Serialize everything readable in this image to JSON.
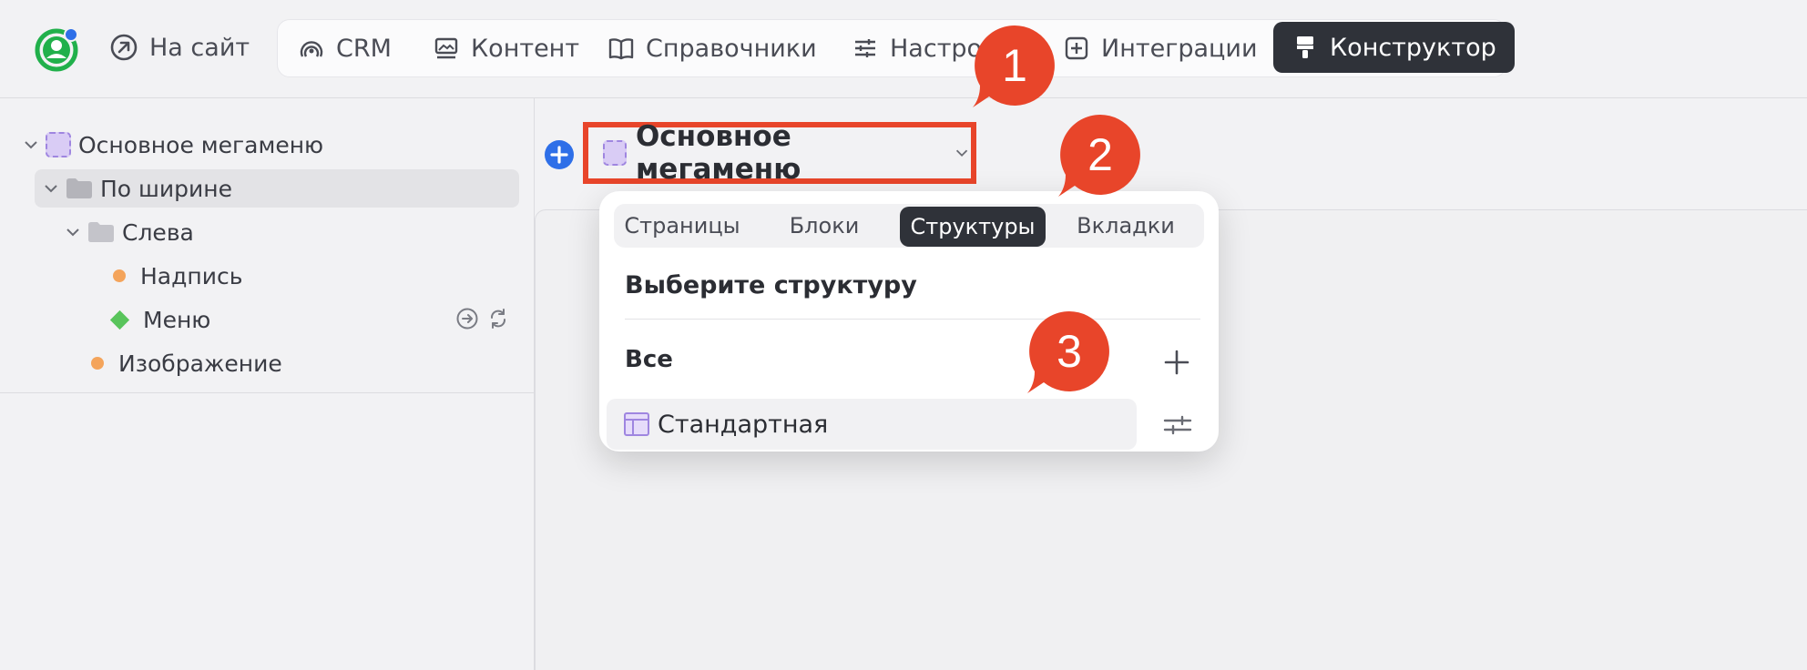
{
  "topbar": {
    "site_link": "На сайт",
    "nav": [
      {
        "label": "CRM",
        "icon": "crm-icon"
      },
      {
        "label": "Контент",
        "icon": "content-icon"
      },
      {
        "label": "Справочники",
        "icon": "book-icon"
      },
      {
        "label": "Настро",
        "icon": "sliders-icon"
      },
      {
        "label": "Интеграции",
        "icon": "plus-square-icon"
      },
      {
        "label": "Конструктор",
        "icon": "brush-icon",
        "active": true
      }
    ]
  },
  "tree": {
    "items": [
      {
        "label": "Основное мегаменю"
      },
      {
        "label": "По ширине",
        "selected": true
      },
      {
        "label": "Слева"
      },
      {
        "label": "Надпись"
      },
      {
        "label": "Меню"
      },
      {
        "label": "Изображение"
      }
    ]
  },
  "main": {
    "menu_select": "Основное мегаменю"
  },
  "popup": {
    "tabs": [
      {
        "label": "Страницы"
      },
      {
        "label": "Блоки"
      },
      {
        "label": "Структуры",
        "active": true
      },
      {
        "label": "Вкладки"
      }
    ],
    "title": "Выберите структуру",
    "section": "Все",
    "items": [
      {
        "label": "Стандартная"
      }
    ]
  },
  "callouts": [
    "1",
    "2",
    "3"
  ],
  "colors": {
    "accent": "#e8452a",
    "active_dark": "#2f3239",
    "primary_blue": "#2e6fe8",
    "logo_green": "#21b04b"
  }
}
